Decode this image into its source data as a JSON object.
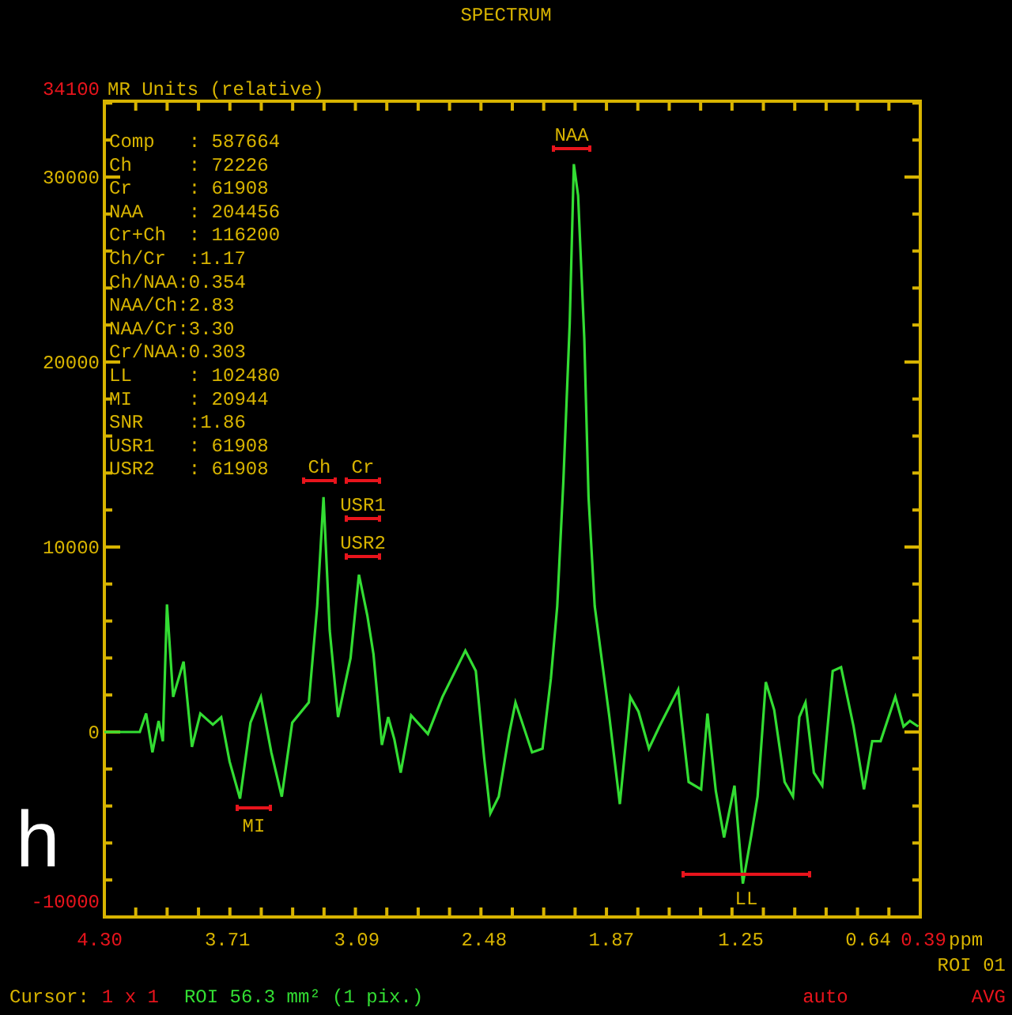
{
  "title": "SPECTRUM",
  "plot": {
    "y_range_labels": [
      "34100",
      "-10000"
    ],
    "x_range_labels": [
      "4.30",
      "0.39"
    ],
    "roi_label": "ROI 01",
    "panel_label": "h",
    "stats": [
      "Comp   : 587664",
      "Ch     : 72226",
      "Cr     : 61908",
      "NAA    : 204456",
      "Cr+Ch  : 116200",
      "Ch/Cr  :1.17",
      "Ch/NAA:0.354",
      "NAA/Ch:2.83",
      "NAA/Cr:3.30",
      "Cr/NAA:0.303",
      "LL     : 102480",
      "MI     : 20944",
      "SNR    :1.86",
      "USR1   : 61908",
      "USR2   : 61908"
    ],
    "chart_data": {
      "type": "line",
      "ylabel": "MR Units (relative)",
      "xlabel": "ppm",
      "xlim": [
        4.3,
        0.39
      ],
      "ylim": [
        -10000,
        34100
      ],
      "xticks": [
        {
          "value": 3.71,
          "label": "3.71"
        },
        {
          "value": 3.09,
          "label": "3.09"
        },
        {
          "value": 2.48,
          "label": "2.48"
        },
        {
          "value": 1.87,
          "label": "1.87"
        },
        {
          "value": 1.25,
          "label": "1.25"
        },
        {
          "value": 0.64,
          "label": "0.64"
        }
      ],
      "yticks": [
        0,
        10000,
        20000,
        30000
      ],
      "x": [
        4.3,
        4.13,
        4.1,
        4.07,
        4.04,
        4.02,
        4.0,
        3.97,
        3.92,
        3.88,
        3.84,
        3.78,
        3.74,
        3.7,
        3.65,
        3.6,
        3.55,
        3.5,
        3.45,
        3.4,
        3.32,
        3.28,
        3.25,
        3.22,
        3.18,
        3.12,
        3.08,
        3.04,
        3.01,
        2.97,
        2.94,
        2.91,
        2.88,
        2.83,
        2.75,
        2.68,
        2.57,
        2.52,
        2.48,
        2.45,
        2.41,
        2.36,
        2.33,
        2.25,
        2.2,
        2.16,
        2.13,
        2.1,
        2.07,
        2.05,
        2.03,
        2.0,
        1.98,
        1.95,
        1.88,
        1.83,
        1.78,
        1.74,
        1.69,
        1.64,
        1.55,
        1.5,
        1.44,
        1.41,
        1.37,
        1.33,
        1.28,
        1.24,
        1.2,
        1.17,
        1.13,
        1.09,
        1.04,
        1.0,
        0.97,
        0.94,
        0.9,
        0.86,
        0.81,
        0.77,
        0.71,
        0.66,
        0.62,
        0.58,
        0.51,
        0.47,
        0.44,
        0.4
      ],
      "series": [
        {
          "color": "#33dd33",
          "values": [
            0,
            0,
            1000,
            -1100,
            600,
            -500,
            6900,
            1900,
            3800,
            -800,
            1000,
            400,
            800,
            -1600,
            -3600,
            500,
            1900,
            -1100,
            -3500,
            500,
            1600,
            6800,
            12700,
            5500,
            800,
            4000,
            8500,
            6300,
            4200,
            -700,
            800,
            -400,
            -2200,
            900,
            -100,
            1900,
            4400,
            3300,
            -1400,
            -4400,
            -3500,
            -100,
            1600,
            -1100,
            -900,
            2900,
            6800,
            13600,
            22100,
            30700,
            29000,
            21300,
            12700,
            6800,
            800,
            -3900,
            1900,
            1100,
            -900,
            300,
            2300,
            -2700,
            -3100,
            1000,
            -3200,
            -5700,
            -2900,
            -8200,
            -5600,
            -3500,
            2700,
            1200,
            -2700,
            -3500,
            800,
            1600,
            -2200,
            -2900,
            3300,
            3500,
            300,
            -3100,
            -500,
            -500,
            1900,
            300,
            600,
            300
          ]
        }
      ],
      "annotations": [
        "NAA",
        "Ch",
        "Cr",
        "USR1",
        "USR2",
        "MI",
        "LL"
      ]
    }
  },
  "status_bar": {
    "cursor_label": "Cursor:",
    "cursor_size": "1 x 1",
    "roi": "ROI 56.3 mm² (1 pix.)",
    "scale_mode": "auto",
    "mode": "AVG"
  }
}
